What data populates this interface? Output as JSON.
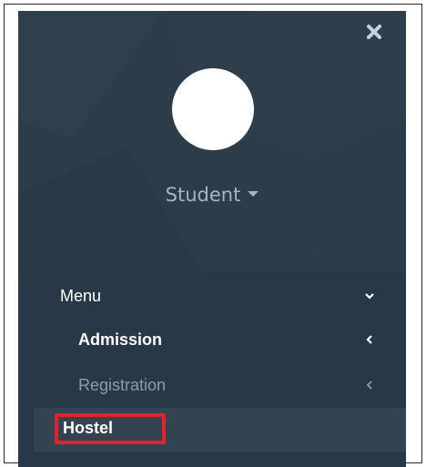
{
  "profile": {
    "username": "Student",
    "close_icon": "close-icon",
    "dropdown_icon": "caret-down-icon"
  },
  "menu": {
    "header_label": "Menu",
    "items": [
      {
        "label": "Admission",
        "icon": "chevron-left-icon"
      },
      {
        "label": "Registration",
        "icon": "chevron-left-icon"
      },
      {
        "label": "Hostel",
        "highlighted": true
      }
    ]
  },
  "colors": {
    "panel": "#2a3a47",
    "highlight_border": "#e3232b",
    "active_row": "#33434f"
  }
}
